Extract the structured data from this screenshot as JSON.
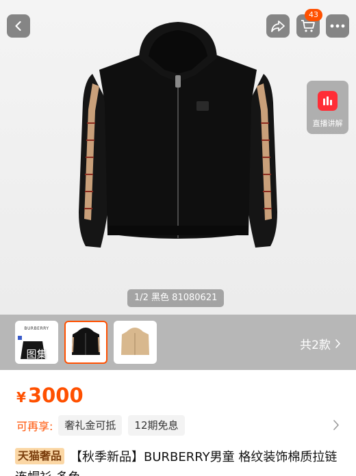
{
  "header": {
    "back_icon": "chevron-left-icon",
    "share_icon": "share-arrow-icon",
    "cart_icon": "cart-icon",
    "cart_badge": "43",
    "more_icon": "more-dots-icon"
  },
  "live": {
    "icon": "live-bars-icon",
    "label": "直播讲解"
  },
  "gallery": {
    "counter": "1/2 黑色 81080621",
    "thumbnails": [
      {
        "label": "图集",
        "brand": "BURBERRY",
        "kind": "album"
      },
      {
        "label": "",
        "kind": "black-hoodie",
        "selected": true
      },
      {
        "label": "",
        "kind": "beige-hoodie"
      }
    ],
    "total_text": "共2款",
    "total_icon": "chevron-right-icon"
  },
  "price": {
    "currency": "¥",
    "amount": "3000"
  },
  "promos": {
    "lead": "可再享:",
    "tags": [
      "奢礼金可抵",
      "12期免息"
    ],
    "arrow_icon": "chevron-right-icon"
  },
  "title": {
    "badge": "天猫奢品",
    "text": "【秋季新品】BURBERRY男童 格纹装饰棉质拉链连帽衫 多色"
  },
  "colors": {
    "accent": "#ff5000",
    "thumb_strip": "#b7b7b7",
    "live_red": "#ff2d36"
  }
}
